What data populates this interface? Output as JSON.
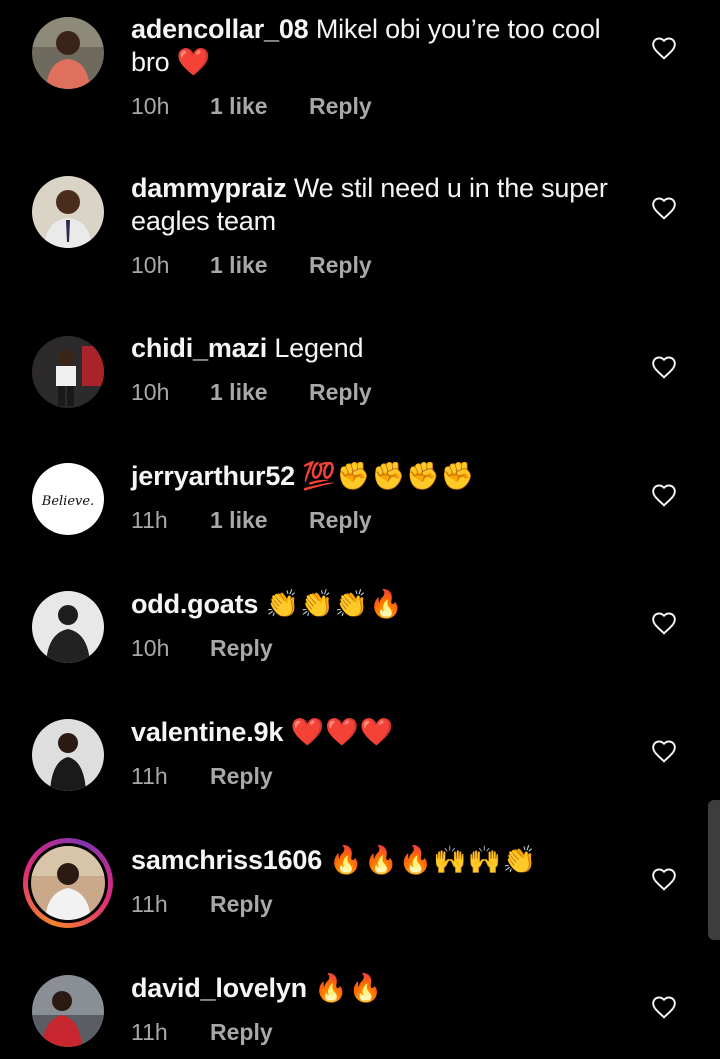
{
  "comments": [
    {
      "username": "adencollar_08",
      "text": "Mikel obi you’re too cool bro",
      "emoji": "❤️",
      "time": "10h",
      "likes": "1 like",
      "reply": "Reply"
    },
    {
      "username": "dammypraiz",
      "text": "We stil need u in the super eagles team",
      "emoji": "",
      "time": "10h",
      "likes": "1 like",
      "reply": "Reply"
    },
    {
      "username": "chidi_mazi",
      "text": "Legend",
      "emoji": "",
      "time": "10h",
      "likes": "1 like",
      "reply": "Reply"
    },
    {
      "username": "jerryarthur52",
      "text": "",
      "emoji": "💯✊✊✊✊",
      "time": "11h",
      "likes": "1 like",
      "reply": "Reply",
      "avatar_text": "Believe."
    },
    {
      "username": "odd.goats",
      "text": "",
      "emoji": "👏👏👏🔥",
      "time": "10h",
      "likes": "",
      "reply": "Reply"
    },
    {
      "username": "valentine.9k",
      "text": "",
      "emoji": "❤️❤️❤️",
      "time": "11h",
      "likes": "",
      "reply": "Reply"
    },
    {
      "username": "samchriss1606",
      "text": "",
      "emoji": "🔥🔥🔥🙌🙌👏",
      "time": "11h",
      "likes": "",
      "reply": "Reply"
    },
    {
      "username": "david_lovelyn",
      "text": "",
      "emoji": "🔥🔥",
      "time": "11h",
      "likes": "",
      "reply": "Reply"
    }
  ],
  "colors": {
    "background": "#000000",
    "text": "#f5f5f5",
    "secondary": "#a8a8a8",
    "heart_outline": "#f5f5f5"
  },
  "icons": {
    "like": "heart-outline-icon"
  }
}
